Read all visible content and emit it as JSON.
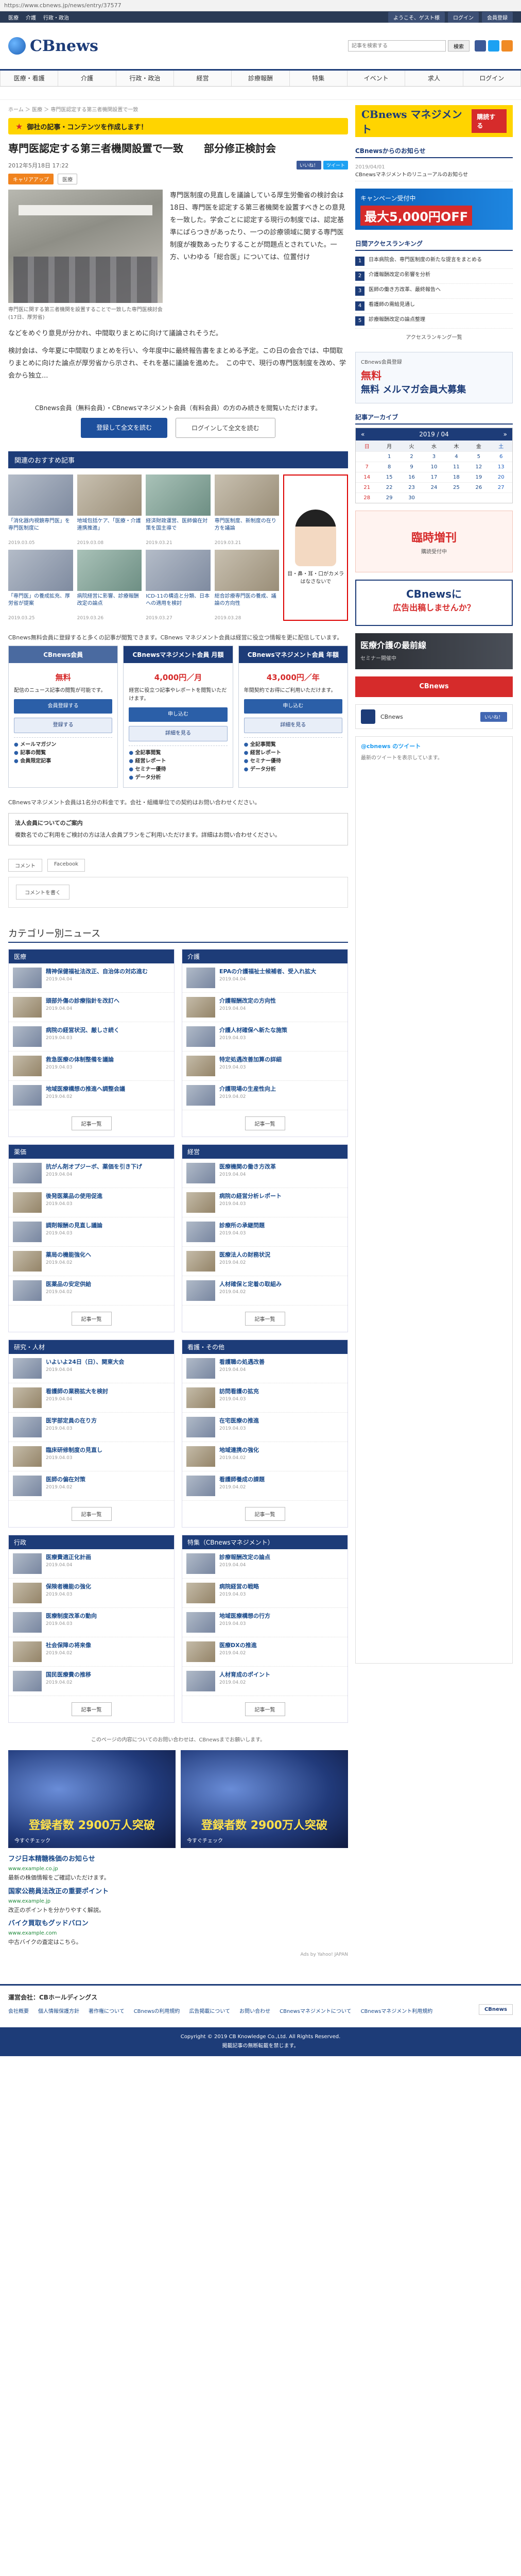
{
  "url": "https://www.cbnews.jp/news/entry/37577",
  "topbar": {
    "left": [
      "医療",
      "介護",
      "行政・政治"
    ],
    "right": [
      "ようこそ、ゲスト様",
      "ログイン",
      "会員登録"
    ]
  },
  "header": {
    "logo": "CBnews",
    "search_placeholder": "記事を検索する",
    "search_button": "検索"
  },
  "nav": [
    "医療・看護",
    "介護",
    "行政・政治",
    "経営",
    "診療報酬",
    "特集",
    "イベント",
    "求人",
    "ログイン"
  ],
  "breadcrumb": "ホーム ＞ 医療 ＞ 専門医認定する第三者機関設置で一致",
  "banner": "御社の記事・コンテンツを作成します！",
  "article": {
    "title": "専門医認定する第三者機関設置で一致　　部分修正検討会",
    "date": "2012年5月18日 17:22",
    "tags": [
      "医療",
      "キャリアアップ"
    ],
    "social": [
      "いいね！",
      "ツイート"
    ],
    "caption": "専門医に関する第三者機関を設置することで一致した専門医検討会(17日、厚労省)",
    "lead": "専門医制度の見直しを議論している厚生労働省の検討会は18日、専門医を認定する第三者機関を設置すべきとの意見を一致した。学会ごとに認定する現行の制度では、認定基準にばらつきがあったり、一つの診療領域に関する専門医制度が複数あったりすることが問題点とされていた。一方、いわゆる「総合医」については、位置付け",
    "para1": "などをめぐり意見が分かれ、中間取りまとめに向けて議論されそうだ。",
    "para2": "検討会は、今年夏に中間取りまとめを行い、今年度中に最終報告書をまとめる予定。この日の会合では、中間取りまとめに向けた論点が厚労省から示され、それを基に議論を進めた。　この中で、現行の専門医制度を改め、学会から独立..."
  },
  "member": {
    "note": "CBnews会員（無料会員）・CBnewsマネジメント会員（有料会員）の方のみ続きを閲覧いただけます。",
    "register_label": "登録して全文を読む",
    "login_label": "ログインして全文を読む"
  },
  "reco": {
    "heading": "関連のおすすめ記事",
    "items": [
      {
        "title": "「消化器内視鏡専門医」を専門医制度に",
        "date": "2019.03.05"
      },
      {
        "title": "地域包括ケア、「医療・介護連携推進」",
        "date": "2019.03.08"
      },
      {
        "title": "経済財政運営、医師偏在対策を国主導で",
        "date": "2019.03.21"
      },
      {
        "title": "専門医制度、新制度の在り方を議論",
        "date": "2019.03.21"
      },
      {
        "title": "「専門医」の養成拡充、厚労省が提案",
        "date": "2019.03.25"
      },
      {
        "title": "病院経営に影響、診療報酬改定の論点",
        "date": "2019.03.26"
      },
      {
        "title": "ICD-11の構造と分類、日本への適用を検討",
        "date": "2019.03.27"
      },
      {
        "title": "総合診療専門医の養成、議論の方向性",
        "date": "2019.03.28"
      },
      {
        "title": "医療従事者の働き方改革、検討会報告",
        "date": "2019.04.01"
      }
    ],
    "ad_text": "目・鼻・耳・口がカメラ\nはなさないで"
  },
  "plans": {
    "intro": "CBnews無料会員に登録すると多くの記事が閲覧できます。CBnews マネジメント会員は経営に役立つ情報を更に配信しています。",
    "items": [
      {
        "name": "CBnews会員",
        "price": "無料",
        "desc": "配信のニュース記事の閲覧が可能です。",
        "buttons": [
          "会員登録する",
          "登録する"
        ],
        "services": [
          "メールマガジン",
          "記事の閲覧",
          "会員限定記事"
        ]
      },
      {
        "name": "CBnewsマネジメント会員 月額",
        "price": "4,000円／月",
        "desc": "経営に役立つ記事やレポートを閲覧いただけます。",
        "buttons": [
          "申し込む",
          "詳細を見る"
        ],
        "services": [
          "全記事閲覧",
          "経営レポート",
          "セミナー優待",
          "データ分析"
        ]
      },
      {
        "name": "CBnewsマネジメント会員 年額",
        "price": "43,000円／年",
        "desc": "年間契約でお得にご利用いただけます。",
        "buttons": [
          "申し込む",
          "詳細を見る"
        ],
        "services": [
          "全記事閲覧",
          "経営レポート",
          "セミナー優待",
          "データ分析"
        ]
      }
    ],
    "note": "CBnewsマネジメント会員は1名分の料金です。会社・組織単位での契約はお問い合わせください。",
    "corp_title": "法人会員についてのご案内",
    "corp_body": "複数名でのご利用をご検討の方は法人会員プランをご利用いただけます。詳細はお問い合わせください。"
  },
  "comments": {
    "tabs": [
      "コメント",
      "Facebook"
    ],
    "button": "コメントを書く"
  },
  "categories": {
    "title": "カテゴリー別ニュース",
    "more": "記事一覧",
    "groups": [
      {
        "name": "医療",
        "rows": [
          {
            "t": "精神保健福祉法改正、自治体の対応進む",
            "d": "2019.04.04"
          },
          {
            "t": "頭部外傷の診療指針を改訂へ",
            "d": "2019.04.04"
          },
          {
            "t": "病院の経営状況、厳しさ続く",
            "d": "2019.04.03"
          },
          {
            "t": "救急医療の体制整備を議論",
            "d": "2019.04.03"
          },
          {
            "t": "地域医療構想の推進へ調整会議",
            "d": "2019.04.02"
          }
        ]
      },
      {
        "name": "介護",
        "rows": [
          {
            "t": "EPAの介護福祉士候補者、受入れ拡大",
            "d": "2019.04.04"
          },
          {
            "t": "介護報酬改定の方向性",
            "d": "2019.04.04"
          },
          {
            "t": "介護人材確保へ新たな施策",
            "d": "2019.04.03"
          },
          {
            "t": "特定処遇改善加算の詳細",
            "d": "2019.04.03"
          },
          {
            "t": "介護現場の生産性向上",
            "d": "2019.04.02"
          }
        ]
      },
      {
        "name": "薬価",
        "rows": [
          {
            "t": "抗がん剤オプジーボ、薬価を引き下げ",
            "d": "2019.04.04"
          },
          {
            "t": "後発医薬品の使用促進",
            "d": "2019.04.03"
          },
          {
            "t": "調剤報酬の見直し議論",
            "d": "2019.04.03"
          },
          {
            "t": "薬局の機能強化へ",
            "d": "2019.04.02"
          },
          {
            "t": "医薬品の安定供給",
            "d": "2019.04.02"
          }
        ]
      },
      {
        "name": "経営",
        "rows": [
          {
            "t": "医療機関の働き方改革",
            "d": "2019.04.04"
          },
          {
            "t": "病院の経営分析レポート",
            "d": "2019.04.03"
          },
          {
            "t": "診療所の承継問題",
            "d": "2019.04.03"
          },
          {
            "t": "医療法人の財務状況",
            "d": "2019.04.02"
          },
          {
            "t": "人材確保と定着の取組み",
            "d": "2019.04.02"
          }
        ]
      },
      {
        "name": "研究・人材",
        "rows": [
          {
            "t": "いよいよ24日（日）、関東大会",
            "d": "2019.04.04"
          },
          {
            "t": "看護師の業務拡大を検討",
            "d": "2019.04.04"
          },
          {
            "t": "医学部定員の在り方",
            "d": "2019.04.03"
          },
          {
            "t": "臨床研修制度の見直し",
            "d": "2019.04.03"
          },
          {
            "t": "医師の偏在対策",
            "d": "2019.04.02"
          }
        ]
      },
      {
        "name": "看護・その他",
        "rows": [
          {
            "t": "看護職の処遇改善",
            "d": "2019.04.04"
          },
          {
            "t": "訪問看護の拡充",
            "d": "2019.04.03"
          },
          {
            "t": "在宅医療の推進",
            "d": "2019.04.03"
          },
          {
            "t": "地域連携の強化",
            "d": "2019.04.02"
          },
          {
            "t": "看護師養成の課題",
            "d": "2019.04.02"
          }
        ]
      },
      {
        "name": "行政",
        "rows": [
          {
            "t": "医療費適正化計画",
            "d": "2019.04.04"
          },
          {
            "t": "保険者機能の強化",
            "d": "2019.04.03"
          },
          {
            "t": "医療制度改革の動向",
            "d": "2019.04.03"
          },
          {
            "t": "社会保障の将来像",
            "d": "2019.04.02"
          },
          {
            "t": "国民医療費の推移",
            "d": "2019.04.02"
          }
        ]
      },
      {
        "name": "特集（CBnewsマネジメント）",
        "rows": [
          {
            "t": "診療報酬改定の論点",
            "d": "2019.04.04"
          },
          {
            "t": "病院経営の戦略",
            "d": "2019.04.03"
          },
          {
            "t": "地域医療構想の行方",
            "d": "2019.04.03"
          },
          {
            "t": "医療DXの推進",
            "d": "2019.04.02"
          },
          {
            "t": "人材育成のポイント",
            "d": "2019.04.02"
          }
        ]
      }
    ]
  },
  "bottom_note": "このページの内容についてのお問い合わせは、CBnewsまでお願いします。",
  "big_ads": [
    {
      "copy": "登録者数 2900万人突破",
      "sub": "今すぐチェック"
    },
    {
      "copy": "登録者数 2900万人突破",
      "sub": "今すぐチェック"
    }
  ],
  "text_ads": [
    {
      "title": "フジ日本精糖株価のお知らせ",
      "url": "www.example.co.jp",
      "desc": "最新の株価情報をご確認いただけます。"
    },
    {
      "title": "国家公務員法改正の重要ポイント",
      "url": "www.example.jp",
      "desc": "改正のポイントを分かりやすく解説。"
    },
    {
      "title": "バイク買取もグッドバロン",
      "url": "www.example.com",
      "desc": "中古バイクの査定はこちら。"
    }
  ],
  "ads_by": "Ads by Yahoo! JAPAN",
  "side": {
    "ad1_a": "CBnews マネジメント",
    "ad1_b": "購読する",
    "news_heading": "CBnewsからのお知らせ",
    "news": [
      {
        "date": "2019/04/01",
        "text": "CBnewsマネジメントのリニューアルのお知らせ"
      }
    ],
    "ad2_a": "キャンペーン受付中",
    "ad2_b": "最大5,000円OFF",
    "rank_heading": "日間アクセスランキング",
    "rank": [
      "日本病院会、専門医制度の新たな提言をまとめる",
      "介護報酬改定の影響を分析",
      "医師の働き方改革、最終報告へ",
      "看護師の需給見通し",
      "診療報酬改定の論点整理"
    ],
    "rank_more": "アクセスランキング一覧",
    "ad3_a": "CBnews会員登録",
    "ad3_b": "無料 メルマガ会員大募集",
    "ad3_c": "無料",
    "cal_heading": "記事アーカイブ",
    "cal_title": "2019 / 04",
    "cal_prev": "«",
    "cal_next": "»",
    "cal_week": [
      "日",
      "月",
      "火",
      "水",
      "木",
      "金",
      "土"
    ],
    "cal_days": [
      [
        "",
        "1",
        "2",
        "3",
        "4",
        "5",
        "6"
      ],
      [
        "7",
        "8",
        "9",
        "10",
        "11",
        "12",
        "13"
      ],
      [
        "14",
        "15",
        "16",
        "17",
        "18",
        "19",
        "20"
      ],
      [
        "21",
        "22",
        "23",
        "24",
        "25",
        "26",
        "27"
      ],
      [
        "28",
        "29",
        "30",
        "",
        "",
        "",
        ""
      ]
    ],
    "ad4_a": "臨時増刊",
    "ad4_b": "購読受付中",
    "ad5_a": "CBnewsに",
    "ad5_b": "広告出稿しませんか？",
    "ad6_a": "医療介護の最前線",
    "ad6_b": "セミナー開催中",
    "ad7": "CBnews",
    "fb_name": "CBnews",
    "fb_like": "いいね！",
    "tw_title": "@cbnews のツイート",
    "tw_body": "最新のツイートを表示しています。"
  },
  "footer": {
    "title": "運営会社：CBホールディングス",
    "links": [
      "会社概要",
      "個人情報保護方針",
      "著作権について",
      "CBnewsの利用規約",
      "広告掲載について",
      "お問い合わせ",
      "CBnewsマネジメントについて",
      "CBnewsマネジメント利用規約"
    ],
    "logo": "CBnews",
    "copyright": "Copyright © 2019 CB Knowledge Co.,Ltd. All Rights Reserved.",
    "note": "掲載記事の無断転載を禁じます。"
  }
}
